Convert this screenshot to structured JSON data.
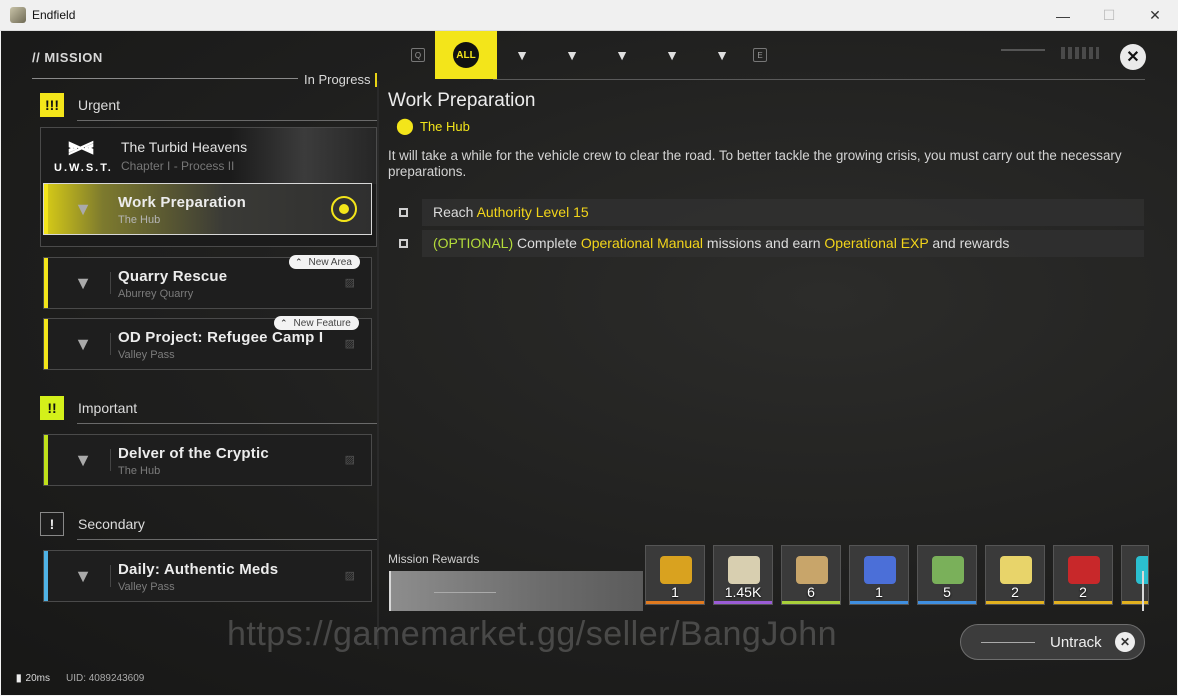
{
  "window": {
    "title": "Endfield",
    "minimize": "—",
    "maximize": "☐",
    "close": "✕"
  },
  "nav": {
    "section_title": "// MISSION",
    "filter": "In Progress",
    "search_glyph": "Q",
    "all_label": "ALL",
    "tab_icons": [
      "▼",
      "▼",
      "▼",
      "▼",
      "▼"
    ],
    "end_glyph": "E",
    "close": "✕"
  },
  "sections": {
    "urgent": {
      "badge": "!!!",
      "label": "Urgent"
    },
    "important": {
      "badge": "!!",
      "label": "Important"
    },
    "secondary": {
      "badge": "!",
      "label": "Secondary"
    }
  },
  "chapter": {
    "title": "The Turbid Heavens",
    "subtitle": "Chapter I - Process II",
    "logo_text": "U.W.S.T."
  },
  "tasks": [
    {
      "title": "Work Preparation",
      "location": "The Hub",
      "active": true
    },
    {
      "title": "Quarry Rescue",
      "location": "Aburrey Quarry",
      "tag": "New Area"
    },
    {
      "title": "OD Project: Refugee Camp I",
      "location": "Valley Pass",
      "tag": "New Feature"
    },
    {
      "title": "Delver of the Cryptic",
      "location": "The Hub"
    },
    {
      "title": "Daily: Authentic Meds",
      "location": "Valley Pass"
    }
  ],
  "detail": {
    "title": "Work Preparation",
    "location": "The Hub",
    "description": "It will take a while for the vehicle crew to clear the road. To better tackle the growing crisis, you must carry out the necessary preparations.",
    "objectives": [
      {
        "prefix": "Reach ",
        "highlight": "Authority Level 15"
      },
      {
        "optional": "(OPTIONAL)",
        "p1": " Complete ",
        "h1": "Operational Manual",
        "p2": " missions and earn ",
        "h2": "Operational EXP",
        "p3": " and rewards"
      }
    ]
  },
  "rewards": {
    "label": "Mission Rewards",
    "items": [
      {
        "name": "gold-crystal-icon",
        "count": "1",
        "color": "#d9a21f",
        "rarity": "#e07a1f"
      },
      {
        "name": "ticket-icon",
        "count": "1.45K",
        "color": "#d8cfb0",
        "rarity": "#9a5cd6"
      },
      {
        "name": "exp-card-icon",
        "count": "6",
        "color": "#c8a56a",
        "rarity": "#a8cf3a"
      },
      {
        "name": "blue-crystal-icon",
        "count": "1",
        "color": "#4b6fd8",
        "rarity": "#3f8fe0"
      },
      {
        "name": "circuit-icon",
        "count": "5",
        "color": "#7ab05a",
        "rarity": "#3f8fe0"
      },
      {
        "name": "manual-book-icon",
        "count": "2",
        "color": "#e8d46a",
        "rarity": "#e2b11f"
      },
      {
        "name": "red-crystal-icon",
        "count": "2",
        "color": "#c8282a",
        "rarity": "#e2b11f"
      },
      {
        "name": "partial-reward-icon",
        "count": "",
        "color": "#2bbfd0",
        "rarity": "#e2b11f"
      }
    ]
  },
  "watermark": "https://gamemarket.gg/seller/BangJohn",
  "untrack": {
    "label": "Untrack",
    "icon": "✕"
  },
  "status": {
    "ping": "20ms",
    "uid": "UID: 4089243609"
  }
}
